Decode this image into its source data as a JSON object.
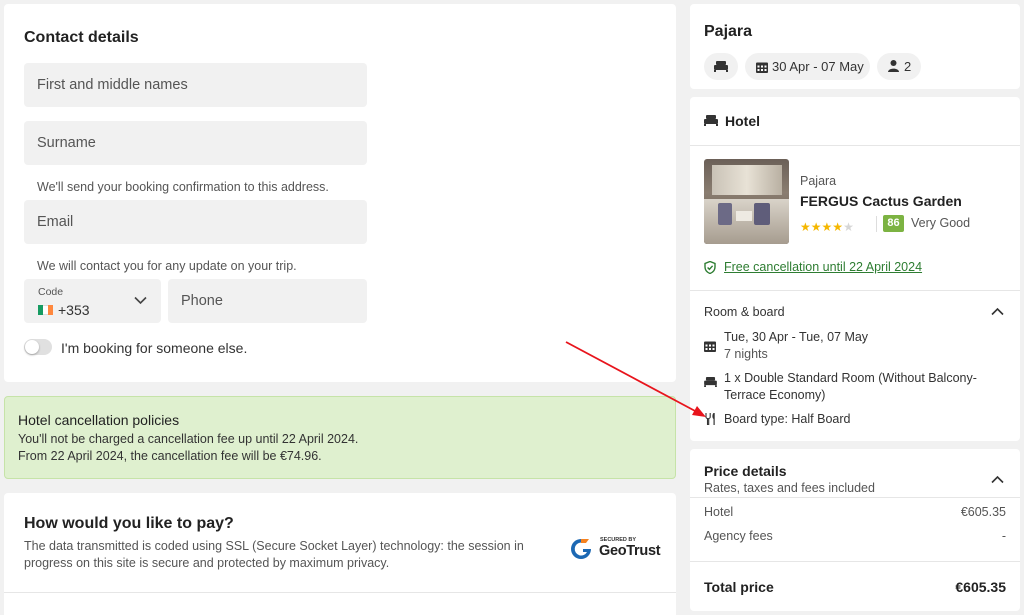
{
  "contact": {
    "title": "Contact details",
    "first_name_placeholder": "First and middle names",
    "surname_placeholder": "Surname",
    "email_hint": "We'll send your booking confirmation to this address.",
    "email_placeholder": "Email",
    "phone_hint": "We will contact you for any update on your trip.",
    "code_label": "Code",
    "code_value": "+353",
    "phone_placeholder": "Phone",
    "someone_else_label": "I'm booking for someone else."
  },
  "cancellation": {
    "title": "Hotel cancellation policies",
    "line1": "You'll not be charged a cancellation fee up until 22 April 2024.",
    "line2": "From 22 April 2024, the cancellation fee will be €74.96."
  },
  "payment": {
    "title": "How would you like to pay?",
    "description": "The data transmitted is coded using SSL (Secure Socket Layer) technology: the session in progress on this site is secure and protected by maximum privacy.",
    "geotrust_small": "SECURED BY",
    "geotrust_brand": "GeoTrust"
  },
  "trip": {
    "destination": "Pajara",
    "dates": "30 Apr - 07 May",
    "guests": "2"
  },
  "hotel": {
    "section_title": "Hotel",
    "location": "Pajara",
    "name": "FERGUS Cactus Garden",
    "stars": 4,
    "max_stars": 5,
    "score": "86",
    "score_label": "Very Good",
    "free_cancellation": "Free cancellation until 22 April 2024"
  },
  "room": {
    "title": "Room & board",
    "dates": "Tue, 30 Apr - Tue, 07 May",
    "nights": "7 nights",
    "room_type": "1 x Double Standard Room (Without Balcony-Terrace Economy)",
    "board": "Board type: Half Board"
  },
  "price": {
    "title": "Price details",
    "subtitle": "Rates, taxes and fees included",
    "hotel_label": "Hotel",
    "hotel_value": "€605.35",
    "agency_label": "Agency fees",
    "agency_value": "-",
    "total_label": "Total price",
    "total_value": "€605.35"
  },
  "colors": {
    "accent_green": "#2e7d32",
    "score_green": "#7cb342",
    "star_yellow": "#f5b700",
    "policy_bg": "#dff0cf",
    "arrow_red": "#e8141c"
  }
}
